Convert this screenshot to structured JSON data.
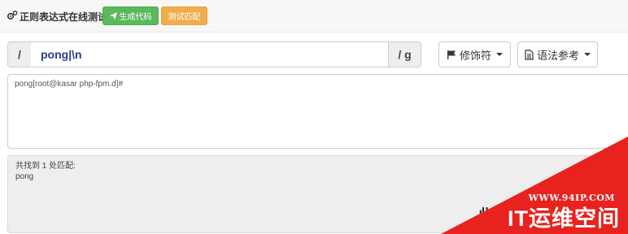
{
  "header": {
    "title": "正则表达式在线测试",
    "generate_label": "生成代码",
    "test_label": "测试匹配"
  },
  "regex": {
    "open_delimiter": "/",
    "pattern": "pong|\\n",
    "flags": "/ g"
  },
  "toolbar": {
    "modifier_label": "修饰符",
    "syntax_label": "语法参考"
  },
  "test_text": "pong[root@kasar php-fpm.d]#",
  "result": {
    "count_text": "共找到 1 处匹配:",
    "matches": [
      "pong"
    ],
    "partial_text": "此"
  },
  "watermark": {
    "url": "WWW.94IP.COM",
    "brand": "IT运维空间"
  },
  "colors": {
    "success": "#5cb85c",
    "warning": "#f0ad4e",
    "watermark": "#e8231f"
  },
  "icons": {
    "title": "gears-icon",
    "generate": "send-icon",
    "modifier": "flag-icon",
    "syntax": "document-icon"
  }
}
